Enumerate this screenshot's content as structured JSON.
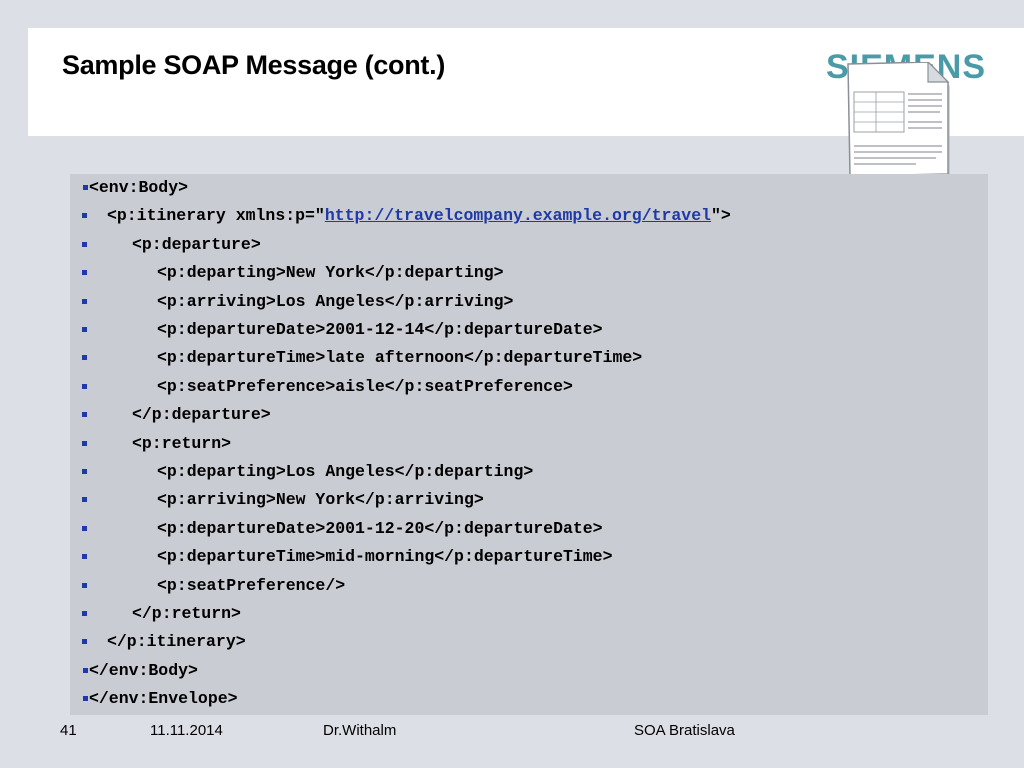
{
  "slide": {
    "title": "Sample SOAP Message (cont.)",
    "logo_text": "SIEMENS"
  },
  "code_lines": [
    {
      "indent": 0,
      "text": "<env:Body>"
    },
    {
      "indent": 1,
      "pre": "<p:itinerary xmlns:p=\"",
      "link": "http://travelcompany.example.org/travel",
      "post": "\">"
    },
    {
      "indent": 2,
      "text": "<p:departure>"
    },
    {
      "indent": 3,
      "text": "<p:departing>New York</p:departing>"
    },
    {
      "indent": 3,
      "text": "<p:arriving>Los Angeles</p:arriving>"
    },
    {
      "indent": 3,
      "text": "<p:departureDate>2001-12-14</p:departureDate>"
    },
    {
      "indent": 3,
      "text": "<p:departureTime>late afternoon</p:departureTime>"
    },
    {
      "indent": 3,
      "text": "<p:seatPreference>aisle</p:seatPreference>"
    },
    {
      "indent": 2,
      "text": "</p:departure>"
    },
    {
      "indent": 2,
      "text": "<p:return>"
    },
    {
      "indent": 3,
      "text": "<p:departing>Los Angeles</p:departing>"
    },
    {
      "indent": 3,
      "text": "<p:arriving>New York</p:arriving>"
    },
    {
      "indent": 3,
      "text": "<p:departureDate>2001-12-20</p:departureDate>"
    },
    {
      "indent": 3,
      "text": "<p:departureTime>mid-morning</p:departureTime>"
    },
    {
      "indent": 3,
      "text": "<p:seatPreference/>"
    },
    {
      "indent": 2,
      "text": "</p:return>"
    },
    {
      "indent": 1,
      "text": "</p:itinerary>"
    },
    {
      "indent": 0,
      "text": "</env:Body>"
    },
    {
      "indent": 0,
      "text": "</env:Envelope>"
    }
  ],
  "footer": {
    "page_number": "41",
    "date": "11.11.2014",
    "author": "Dr.Withalm",
    "event": "SOA Bratislava"
  },
  "colors": {
    "accent": "#1f3aa8",
    "logo": "#4a9ba7",
    "panel": "#c9ccd2",
    "background": "#dcdfe6"
  }
}
